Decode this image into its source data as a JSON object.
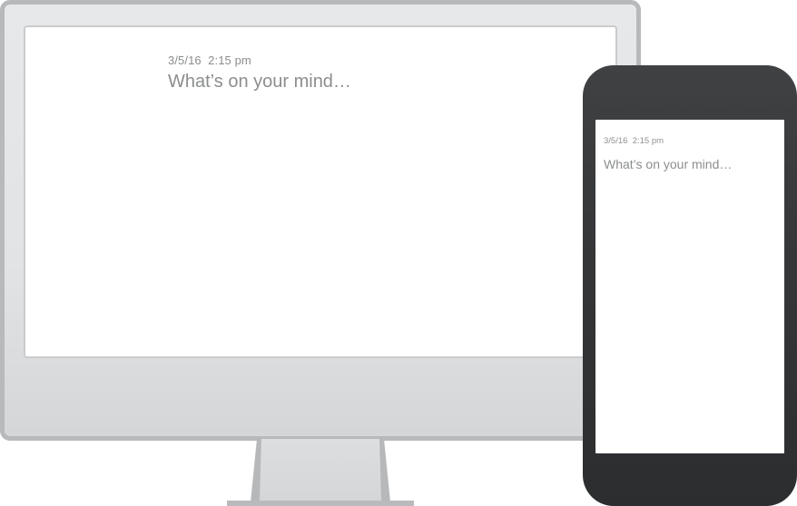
{
  "desktop": {
    "note": {
      "date": "3/5/16  2:15 pm",
      "placeholder": "What’s on your mind…"
    }
  },
  "mobile": {
    "note": {
      "date": "3/5/16  2:15 pm",
      "placeholder": "What’s on your mind…"
    }
  },
  "colors": {
    "monitor_frame": "#b7b9bb",
    "monitor_bezel": "#e3e5e7",
    "phone_body": "#353739",
    "screen": "#ffffff",
    "text": "#8b8d8f"
  }
}
